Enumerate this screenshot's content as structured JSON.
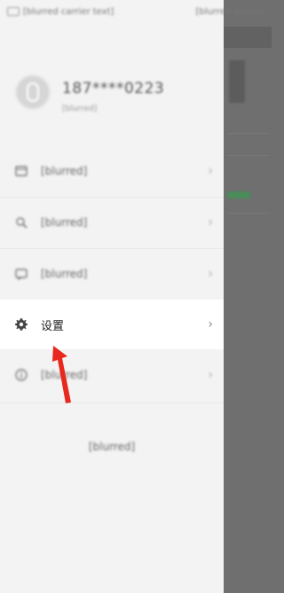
{
  "status_bar": {
    "left_text": "[blurred carrier text]",
    "right_text": "[blurred status]"
  },
  "profile": {
    "phone": "187****0223",
    "subtitle": "[blurred]"
  },
  "menu": {
    "items": [
      {
        "label": "[blurred]",
        "icon": "card-icon"
      },
      {
        "label": "[blurred]",
        "icon": "search-icon"
      },
      {
        "label": "[blurred]",
        "icon": "message-icon"
      },
      {
        "label": "设置",
        "icon": "gear-icon"
      },
      {
        "label": "[blurred]",
        "icon": "info-icon"
      }
    ]
  },
  "logout_label": "[blurred]",
  "colors": {
    "overlay": "#6f6f6f",
    "drawer_bg": "#f3f3f3",
    "active_bg": "#ffffff",
    "accent_green": "#4a8c5a",
    "pointer_red": "#e8281e"
  }
}
